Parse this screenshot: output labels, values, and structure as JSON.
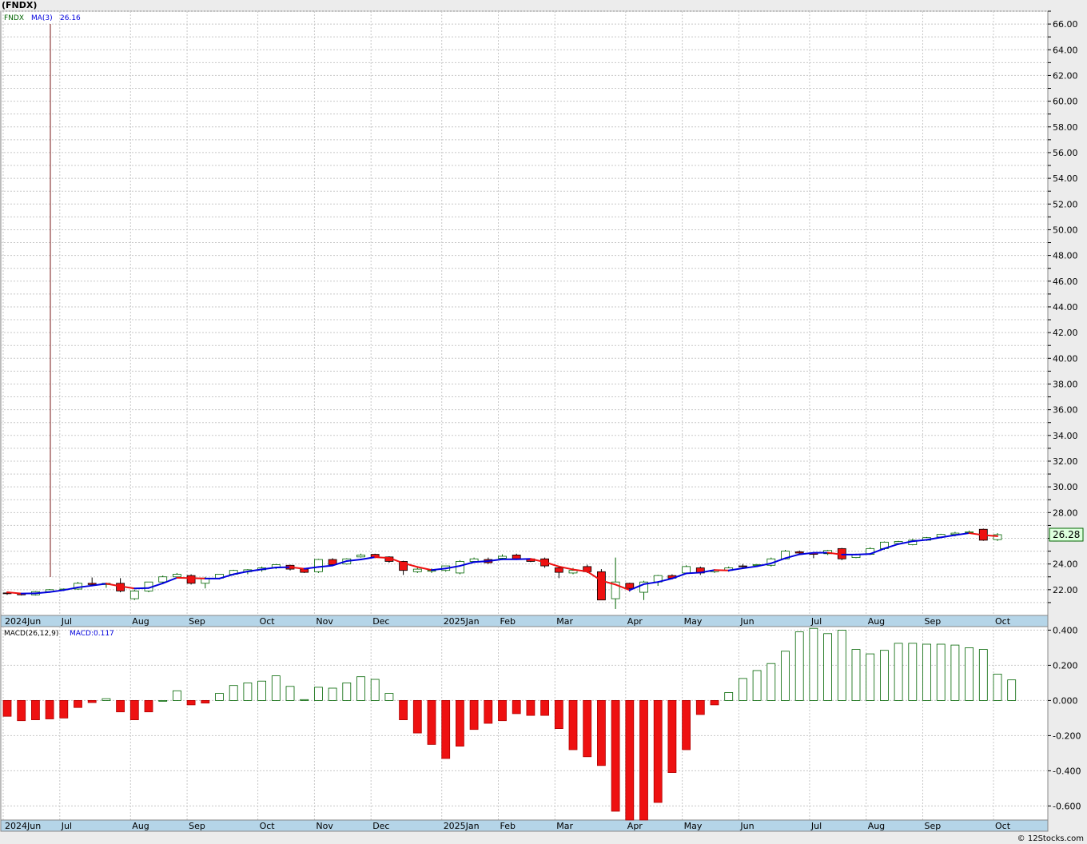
{
  "title": "(FNDX)",
  "credit": "© 12Stocks.com",
  "chart_data": [
    {
      "type": "candlestick",
      "symbol": "FNDX",
      "legend": [
        "FNDX",
        "MA(3)",
        "26.16"
      ],
      "last_price_label": "26.28",
      "ylim": [
        20,
        67
      ],
      "yticks": [
        "66.00",
        "64.00",
        "62.00",
        "60.00",
        "58.00",
        "56.00",
        "54.00",
        "52.00",
        "50.00",
        "48.00",
        "46.00",
        "44.00",
        "42.00",
        "40.00",
        "38.00",
        "36.00",
        "34.00",
        "32.00",
        "30.00",
        "28.00",
        "26.00",
        "24.00",
        "22.00"
      ],
      "colors": {
        "up": "#ffffff",
        "up_border": "#006400",
        "down": "#ee1111",
        "ma_up": "#0000dd",
        "ma_down": "#ee1111"
      },
      "x_labels": [
        {
          "label": "2024Jun",
          "week": 0
        },
        {
          "label": "Jul",
          "week": 4
        },
        {
          "label": "Aug",
          "week": 9
        },
        {
          "label": "Sep",
          "week": 13
        },
        {
          "label": "Oct",
          "week": 18
        },
        {
          "label": "Nov",
          "week": 22
        },
        {
          "label": "Dec",
          "week": 26
        },
        {
          "label": "2025Jan",
          "week": 31
        },
        {
          "label": "Feb",
          "week": 35
        },
        {
          "label": "Mar",
          "week": 39
        },
        {
          "label": "Apr",
          "week": 44
        },
        {
          "label": "May",
          "week": 48
        },
        {
          "label": "Jun",
          "week": 52
        },
        {
          "label": "Jul",
          "week": 57
        },
        {
          "label": "Aug",
          "week": 61
        },
        {
          "label": "Sep",
          "week": 65
        },
        {
          "label": "Oct",
          "week": 70
        }
      ],
      "ohlc": [
        [
          21.75,
          21.85,
          21.6,
          21.7
        ],
        [
          21.7,
          21.75,
          21.55,
          21.6
        ],
        [
          21.6,
          21.9,
          21.55,
          21.85
        ],
        [
          21.85,
          22.05,
          21.8,
          22.0
        ],
        [
          22.0,
          22.1,
          21.9,
          22.05
        ],
        [
          22.05,
          22.6,
          22.0,
          22.5
        ],
        [
          22.5,
          22.95,
          22.3,
          22.4
        ],
        [
          22.4,
          22.55,
          22.15,
          22.5
        ],
        [
          22.5,
          22.9,
          21.8,
          21.9
        ],
        [
          21.3,
          22.0,
          21.2,
          21.9
        ],
        [
          21.9,
          22.6,
          21.8,
          22.6
        ],
        [
          22.6,
          23.1,
          22.5,
          23.0
        ],
        [
          23.0,
          23.3,
          22.9,
          23.2
        ],
        [
          23.1,
          23.2,
          22.4,
          22.5
        ],
        [
          22.5,
          23.0,
          22.1,
          22.9
        ],
        [
          22.9,
          23.2,
          22.8,
          23.2
        ],
        [
          23.2,
          23.55,
          23.1,
          23.5
        ],
        [
          23.4,
          23.6,
          23.2,
          23.55
        ],
        [
          23.55,
          23.8,
          23.4,
          23.7
        ],
        [
          23.7,
          24.0,
          23.6,
          23.95
        ],
        [
          23.9,
          23.95,
          23.5,
          23.6
        ],
        [
          23.6,
          23.7,
          23.3,
          23.35
        ],
        [
          23.4,
          24.4,
          23.3,
          24.35
        ],
        [
          24.35,
          24.45,
          23.9,
          23.95
        ],
        [
          24.0,
          24.45,
          23.95,
          24.4
        ],
        [
          24.55,
          24.8,
          24.5,
          24.7
        ],
        [
          24.75,
          24.8,
          24.45,
          24.5
        ],
        [
          24.55,
          24.6,
          24.1,
          24.2
        ],
        [
          24.2,
          24.25,
          23.15,
          23.5
        ],
        [
          23.4,
          23.7,
          23.3,
          23.6
        ],
        [
          23.5,
          23.65,
          23.3,
          23.5
        ],
        [
          23.5,
          23.8,
          23.4,
          23.85
        ],
        [
          23.3,
          24.3,
          23.2,
          24.2
        ],
        [
          24.2,
          24.5,
          24.1,
          24.4
        ],
        [
          24.35,
          24.5,
          24.0,
          24.1
        ],
        [
          24.45,
          24.75,
          24.35,
          24.6
        ],
        [
          24.7,
          24.8,
          24.35,
          24.4
        ],
        [
          24.4,
          24.45,
          24.15,
          24.2
        ],
        [
          24.4,
          24.5,
          23.7,
          23.85
        ],
        [
          23.7,
          23.75,
          22.9,
          23.35
        ],
        [
          23.3,
          23.7,
          23.2,
          23.5
        ],
        [
          23.8,
          23.95,
          23.3,
          23.4
        ],
        [
          23.4,
          23.6,
          22.1,
          21.2
        ],
        [
          21.3,
          24.5,
          20.5,
          22.6
        ],
        [
          22.5,
          22.55,
          21.85,
          22.1
        ],
        [
          21.8,
          22.7,
          21.2,
          22.6
        ],
        [
          22.6,
          23.15,
          22.3,
          23.1
        ],
        [
          23.1,
          23.2,
          22.8,
          22.9
        ],
        [
          23.3,
          23.9,
          23.2,
          23.8
        ],
        [
          23.7,
          23.8,
          23.15,
          23.3
        ],
        [
          23.4,
          23.6,
          23.3,
          23.5
        ],
        [
          23.5,
          23.8,
          23.4,
          23.7
        ],
        [
          23.85,
          24.0,
          23.7,
          23.8
        ],
        [
          23.9,
          24.0,
          23.8,
          23.95
        ],
        [
          23.9,
          24.5,
          23.8,
          24.4
        ],
        [
          24.4,
          25.1,
          24.35,
          25.0
        ],
        [
          24.95,
          25.05,
          24.8,
          24.85
        ],
        [
          24.85,
          24.9,
          24.45,
          24.75
        ],
        [
          24.8,
          25.1,
          24.7,
          25.05
        ],
        [
          25.2,
          25.25,
          24.3,
          24.4
        ],
        [
          24.5,
          24.8,
          24.45,
          24.75
        ],
        [
          24.75,
          25.3,
          24.7,
          25.2
        ],
        [
          25.2,
          25.75,
          25.1,
          25.7
        ],
        [
          25.6,
          25.8,
          25.5,
          25.75
        ],
        [
          25.5,
          25.95,
          25.45,
          25.85
        ],
        [
          25.85,
          26.1,
          25.8,
          26.05
        ],
        [
          26.1,
          26.35,
          26.05,
          26.3
        ],
        [
          26.3,
          26.5,
          26.15,
          26.4
        ],
        [
          26.45,
          26.6,
          26.35,
          26.5
        ],
        [
          26.7,
          26.75,
          25.8,
          25.85
        ],
        [
          25.9,
          26.4,
          25.8,
          26.28
        ]
      ],
      "ma3": [
        21.8,
        21.7,
        21.72,
        21.82,
        21.97,
        22.18,
        22.32,
        22.47,
        22.27,
        22.1,
        22.13,
        22.5,
        22.93,
        22.9,
        22.87,
        22.87,
        23.2,
        23.42,
        23.58,
        23.73,
        23.75,
        23.63,
        23.77,
        23.88,
        24.23,
        24.35,
        24.53,
        24.47,
        24.07,
        23.77,
        23.53,
        23.65,
        23.85,
        24.15,
        24.23,
        24.37,
        24.37,
        24.4,
        24.15,
        23.8,
        23.57,
        23.42,
        22.7,
        22.4,
        21.97,
        22.43,
        22.6,
        22.87,
        23.27,
        23.33,
        23.53,
        23.5,
        23.67,
        23.82,
        24.05,
        24.45,
        24.75,
        24.87,
        24.88,
        24.73,
        24.73,
        24.78,
        25.2,
        25.55,
        25.77,
        25.88,
        26.07,
        26.25,
        26.4,
        26.25,
        26.16
      ]
    },
    {
      "type": "bar",
      "name": "MACD(26,12,9)",
      "legend": [
        "MACD(26,12,9)",
        "MACD:0.117"
      ],
      "ylim": [
        -0.68,
        0.42
      ],
      "yticks": [
        "0.400",
        "0.200",
        "0.000",
        "-0.200",
        "-0.400",
        "-0.600"
      ],
      "colors": {
        "positive_border": "#006400",
        "negative": "#ee1111"
      },
      "values": [
        -0.09,
        -0.115,
        -0.11,
        -0.105,
        -0.1,
        -0.04,
        -0.012,
        0.01,
        -0.065,
        -0.11,
        -0.065,
        0.0,
        0.055,
        -0.025,
        -0.015,
        0.04,
        0.085,
        0.1,
        0.11,
        0.14,
        0.08,
        0.005,
        0.075,
        0.07,
        0.1,
        0.135,
        0.12,
        0.04,
        -0.11,
        -0.185,
        -0.25,
        -0.33,
        -0.26,
        -0.165,
        -0.13,
        -0.115,
        -0.075,
        -0.085,
        -0.085,
        -0.16,
        -0.28,
        -0.32,
        -0.37,
        -0.63,
        -0.72,
        -0.72,
        -0.58,
        -0.41,
        -0.28,
        -0.08,
        -0.025,
        0.045,
        0.125,
        0.17,
        0.21,
        0.28,
        0.39,
        0.41,
        0.38,
        0.4,
        0.29,
        0.265,
        0.285,
        0.325,
        0.325,
        0.32,
        0.32,
        0.315,
        0.3,
        0.29,
        0.15,
        0.117
      ]
    }
  ]
}
